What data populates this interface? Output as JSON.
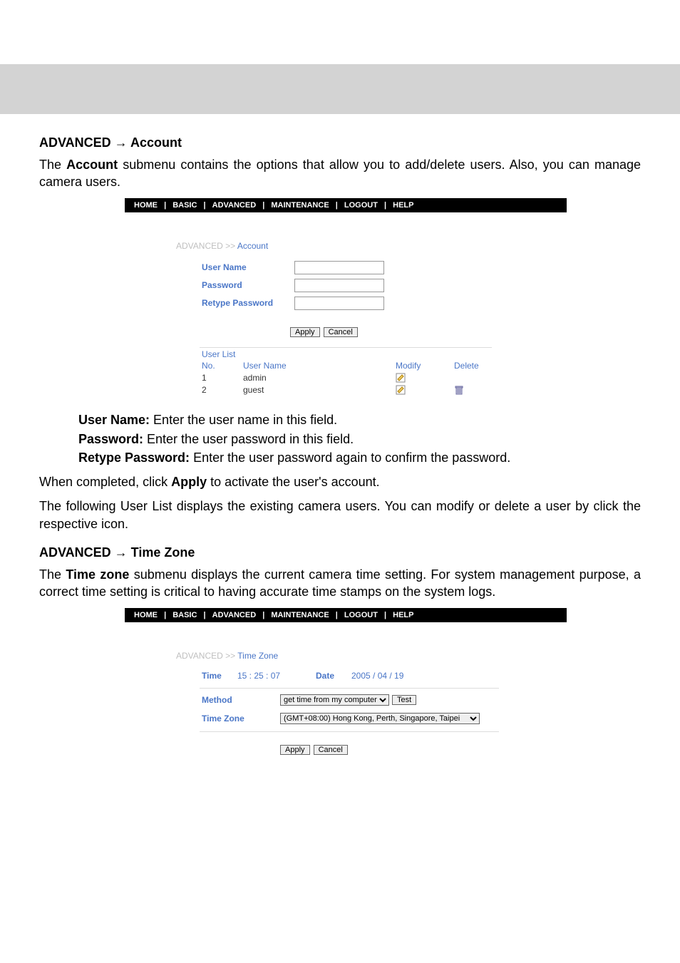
{
  "sections": {
    "account_head": "ADVANCED → Account",
    "timezone_head": "ADVANCED → Time Zone"
  },
  "account_intro": {
    "prefix": "The ",
    "bold": "Account",
    "rest": " submenu contains the options that allow you to add/delete users. Also, you can manage camera users."
  },
  "nav": {
    "home": "HOME",
    "basic": "BASIC",
    "advanced": "ADVANCED",
    "maintenance": "MAINTENANCE",
    "logout": "LOGOUT",
    "help": "HELP",
    "sep": "|"
  },
  "account_panel": {
    "breadcrumb_root": "ADVANCED >> ",
    "breadcrumb_current": "Account",
    "user_name_label": "User Name",
    "password_label": "Password",
    "retype_password_label": "Retype Password",
    "apply": "Apply",
    "cancel": "Cancel",
    "userlist_title": "User List",
    "cols": {
      "no": "No.",
      "username": "User Name",
      "modify": "Modify",
      "delete": "Delete"
    },
    "rows": [
      {
        "no": "1",
        "username": "admin",
        "modify": true,
        "delete": false
      },
      {
        "no": "2",
        "username": "guest",
        "modify": true,
        "delete": true
      }
    ]
  },
  "fields_desc": {
    "username_label": "User Name:",
    "username_text": " Enter the user name in this field.",
    "password_label": "Password:",
    "password_text": " Enter the user password in this field.",
    "retype_label": "Retype Password:",
    "retype_text": " Enter the user password again to confirm the password."
  },
  "apply_note": {
    "prefix": "When completed, click ",
    "bold": "Apply",
    "rest": " to activate the user's account."
  },
  "userlist_note": "The following User List displays the existing camera users.  You can modify or delete a user by click the respective icon.",
  "timezone_intro": {
    "prefix": "The ",
    "bold": "Time zone",
    "rest": " submenu displays the current camera time setting.  For system management purpose, a correct time setting is critical to having accurate time stamps on the system logs."
  },
  "timezone_panel": {
    "breadcrumb_root": "ADVANCED >> ",
    "breadcrumb_current": "Time Zone",
    "time_label": "Time",
    "time_value": "15 : 25 : 07",
    "date_label": "Date",
    "date_value": "2005 / 04 / 19",
    "method_label": "Method",
    "method_value": "get time from my computer",
    "test": "Test",
    "tz_label": "Time Zone",
    "tz_value": "(GMT+08:00) Hong Kong, Perth, Singapore, Taipei",
    "apply": "Apply",
    "cancel": "Cancel"
  }
}
